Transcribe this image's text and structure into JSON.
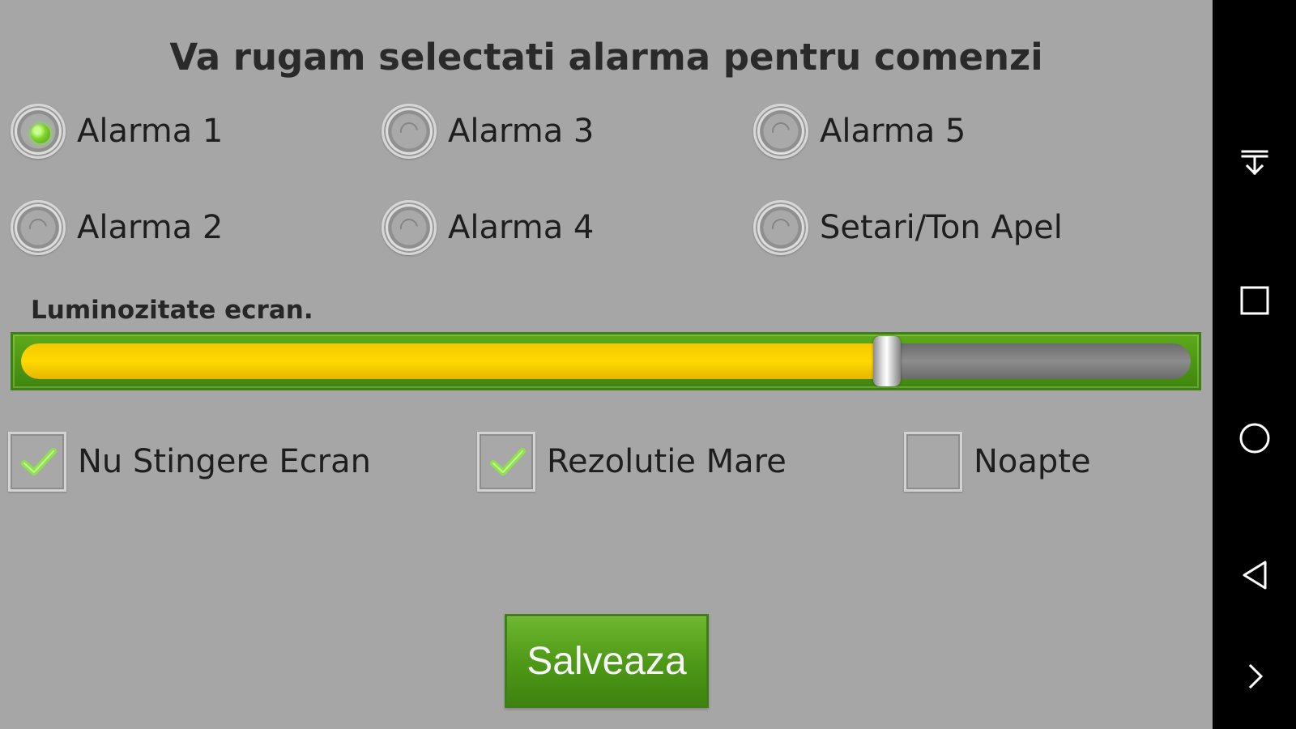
{
  "title": "Va rugam selectati alarma pentru comenzi",
  "radio_options": [
    {
      "label": "Alarma 1",
      "selected": true
    },
    {
      "label": "Alarma 2",
      "selected": false
    },
    {
      "label": "Alarma 3",
      "selected": false
    },
    {
      "label": "Alarma 4",
      "selected": false
    },
    {
      "label": "Alarma 5",
      "selected": false
    },
    {
      "label": "Setari/Ton Apel",
      "selected": false
    }
  ],
  "brightness": {
    "label": "Luminozitate ecran.",
    "value_fraction": 0.74
  },
  "checkboxes": [
    {
      "label": "Nu Stingere Ecran",
      "checked": true
    },
    {
      "label": "Rezolutie Mare",
      "checked": true
    },
    {
      "label": "Noapte",
      "checked": false
    }
  ],
  "save_button": {
    "label": "Salveaza"
  },
  "navigation": {
    "icons": [
      "download-icon",
      "recent-apps-icon",
      "home-icon",
      "back-icon",
      "more-icon"
    ]
  },
  "colors": {
    "background": "#a6a6a6",
    "accent_green": "#5eaa1b",
    "slider_yellow": "#ffd900",
    "nav_background": "#000000"
  }
}
